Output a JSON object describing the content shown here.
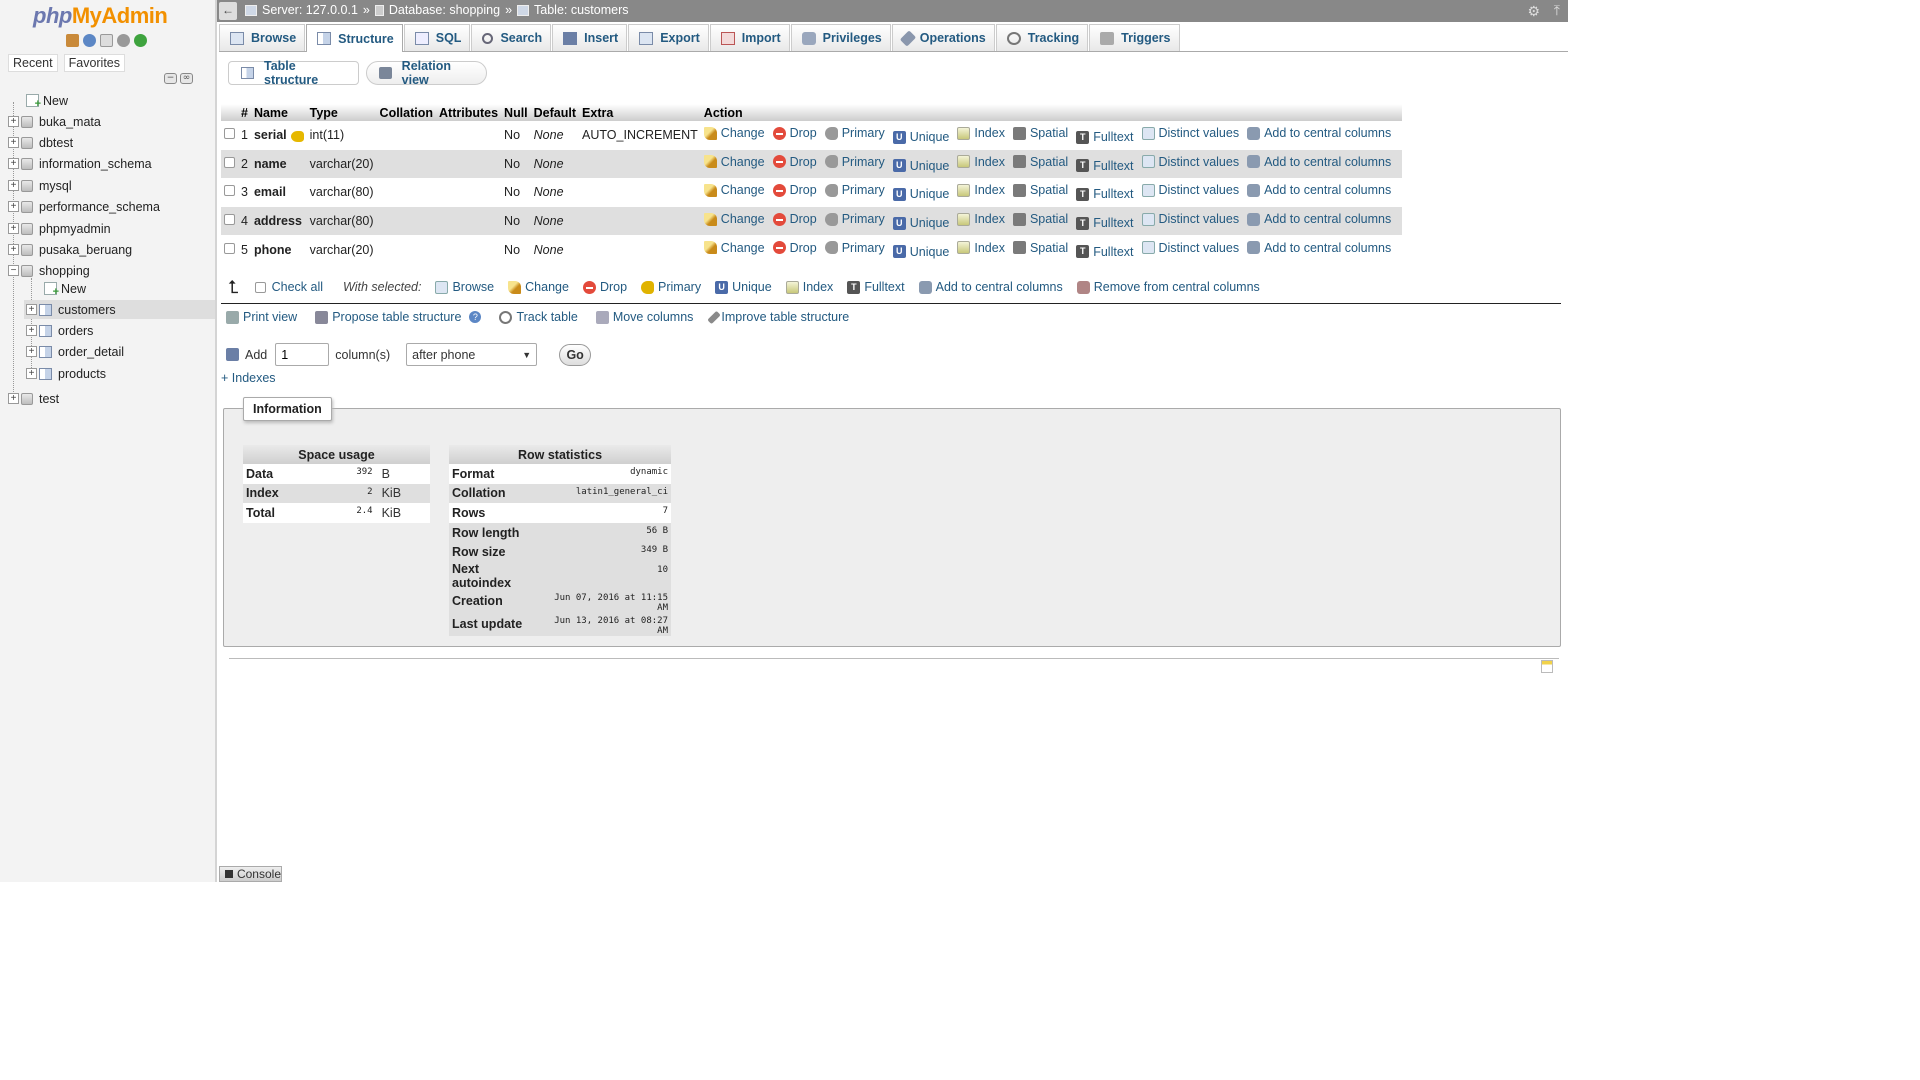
{
  "logo": {
    "part1": "php",
    "part2": "MyAdmin"
  },
  "nav": {
    "tabs": [
      "Recent",
      "Favorites"
    ],
    "new_label": "New",
    "databases": [
      "buka_mata",
      "dbtest",
      "information_schema",
      "mysql",
      "performance_schema",
      "phpmyadmin",
      "pusaka_beruang",
      "shopping",
      "test"
    ],
    "open_db": {
      "name": "shopping",
      "new_label": "New",
      "tables": [
        "customers",
        "orders",
        "order_detail",
        "products"
      ],
      "active_table": "customers"
    }
  },
  "breadcrumb": {
    "server": "Server: 127.0.0.1",
    "sep": "»",
    "database": "Database: shopping",
    "table": "Table: customers"
  },
  "menu_tabs": [
    {
      "label": "Browse",
      "icon": "browse-icon"
    },
    {
      "label": "Structure",
      "icon": "structure-icon",
      "active": true
    },
    {
      "label": "SQL",
      "icon": "sql-icon"
    },
    {
      "label": "Search",
      "icon": "search-icon"
    },
    {
      "label": "Insert",
      "icon": "insert-icon"
    },
    {
      "label": "Export",
      "icon": "export-icon"
    },
    {
      "label": "Import",
      "icon": "import-icon"
    },
    {
      "label": "Privileges",
      "icon": "privileges-icon"
    },
    {
      "label": "Operations",
      "icon": "operations-icon"
    },
    {
      "label": "Tracking",
      "icon": "tracking-icon"
    },
    {
      "label": "Triggers",
      "icon": "triggers-icon"
    }
  ],
  "sub_tabs": {
    "table_structure": "Table structure",
    "relation_view": "Relation view"
  },
  "structure": {
    "headers": [
      "#",
      "Name",
      "Type",
      "Collation",
      "Attributes",
      "Null",
      "Default",
      "Extra",
      "Action"
    ],
    "rows": [
      {
        "num": "1",
        "name": "serial",
        "type": "int(11)",
        "collation": "",
        "attributes": "",
        "null": "No",
        "default": "None",
        "extra": "AUTO_INCREMENT",
        "primary_key": true
      },
      {
        "num": "2",
        "name": "name",
        "type": "varchar(20)",
        "collation": "",
        "attributes": "",
        "null": "No",
        "default": "None",
        "extra": ""
      },
      {
        "num": "3",
        "name": "email",
        "type": "varchar(80)",
        "collation": "",
        "attributes": "",
        "null": "No",
        "default": "None",
        "extra": ""
      },
      {
        "num": "4",
        "name": "address",
        "type": "varchar(80)",
        "collation": "",
        "attributes": "",
        "null": "No",
        "default": "None",
        "extra": ""
      },
      {
        "num": "5",
        "name": "phone",
        "type": "varchar(20)",
        "collation": "",
        "attributes": "",
        "null": "No",
        "default": "None",
        "extra": ""
      }
    ],
    "row_actions": [
      "Change",
      "Drop",
      "Primary",
      "Unique",
      "Index",
      "Spatial",
      "Fulltext",
      "Distinct values",
      "Add to central columns"
    ]
  },
  "with_selected": {
    "check_all": "Check all",
    "label": "With selected:",
    "actions": [
      "Browse",
      "Change",
      "Drop",
      "Primary",
      "Unique",
      "Index",
      "Fulltext",
      "Add to central columns",
      "Remove from central columns"
    ]
  },
  "links": [
    "Print view",
    "Propose table structure",
    "Track table",
    "Move columns",
    "Improve table structure"
  ],
  "add_columns": {
    "label": "Add",
    "value": "1",
    "unit": "column(s)",
    "position": "after phone",
    "go": "Go"
  },
  "indexes_link": "+ Indexes",
  "information": {
    "legend": "Information",
    "space_usage": {
      "title": "Space usage",
      "rows": [
        {
          "key": "Data",
          "value": "392",
          "unit": "B"
        },
        {
          "key": "Index",
          "value": "2",
          "unit": "KiB"
        },
        {
          "key": "Total",
          "value": "2.4",
          "unit": "KiB"
        }
      ]
    },
    "row_statistics": {
      "title": "Row statistics",
      "rows": [
        {
          "key": "Format",
          "value": "dynamic"
        },
        {
          "key": "Collation",
          "value": "latin1_general_ci"
        },
        {
          "key": "Rows",
          "value": "7"
        },
        {
          "key": "Row length",
          "value": "56 B"
        },
        {
          "key": "Row size",
          "value": "349 B"
        },
        {
          "key": "Next autoindex",
          "value": "10"
        },
        {
          "key": "Creation",
          "value": "Jun 07, 2016 at 11:15 AM"
        },
        {
          "key": "Last update",
          "value": "Jun 13, 2016 at 08:27 AM"
        }
      ]
    }
  },
  "console_label": "Console",
  "colors": {
    "link": "#235a81",
    "topbar": "#888888",
    "logo_php": "#6c78af",
    "logo_myadmin": "#f29000"
  }
}
